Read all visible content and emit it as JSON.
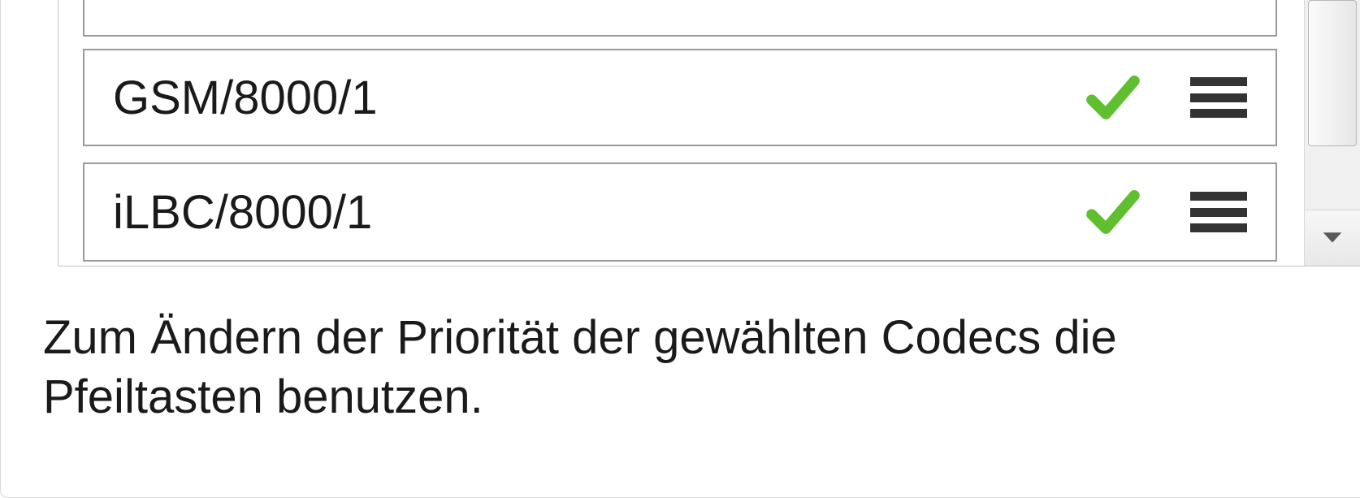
{
  "codecs": [
    {
      "name": "GSM/8000/1",
      "enabled": true
    },
    {
      "name": "iLBC/8000/1",
      "enabled": true
    }
  ],
  "hint": "Zum Ändern der Priorität der gewählten Codecs die Pfeiltasten benutzen.",
  "icons": {
    "check": "check-icon",
    "drag": "hamburger-icon",
    "scroll_down": "chevron-down-icon"
  },
  "colors": {
    "check": "#5fbf2e",
    "bar": "#333333"
  }
}
